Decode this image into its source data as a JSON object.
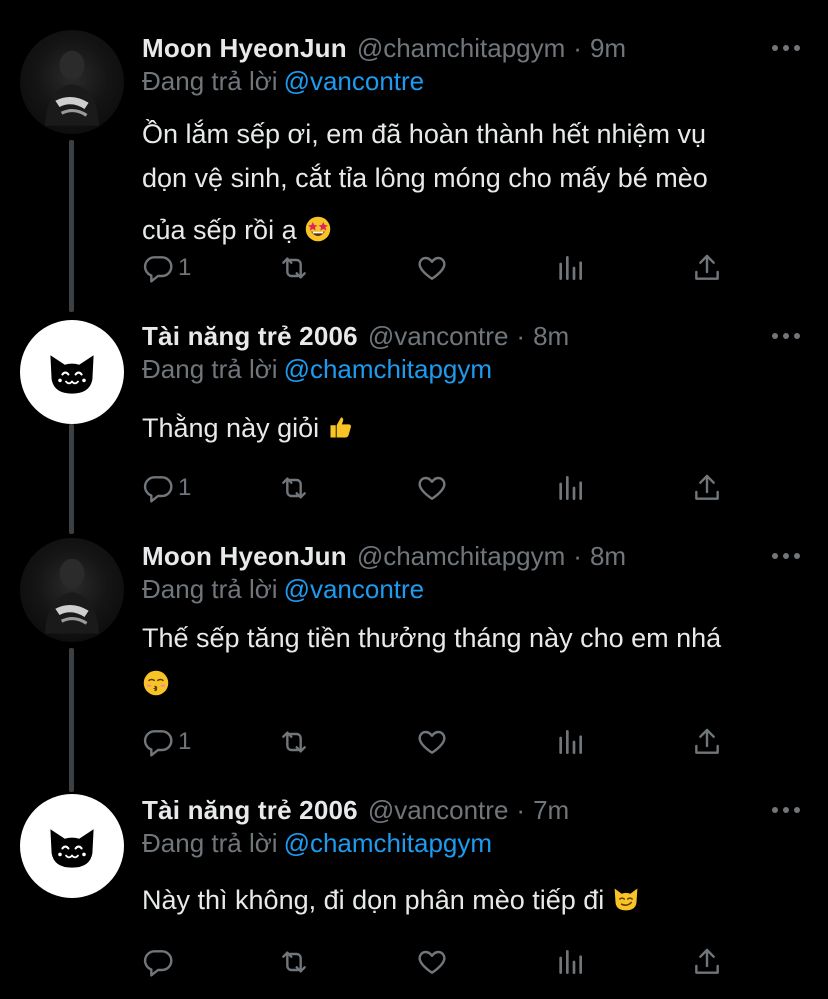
{
  "tweets": [
    {
      "name": "Moon HyeonJun",
      "handle": "@chamchitapgym",
      "time": "9m",
      "replying_prefix": "Đang trả lời",
      "replying_to": "@vancontre",
      "text_lines": [
        "Ồn lắm sếp ơi, em đã hoàn thành hết nhiệm vụ",
        "dọn vệ sinh, cắt tỉa lông móng cho mấy bé mèo",
        "của sếp rồi ạ"
      ],
      "emoji": "star-struck",
      "reply_count": "1",
      "avatar": "dark-photo"
    },
    {
      "name": "Tài năng trẻ 2006",
      "handle": "@vancontre",
      "time": "8m",
      "replying_prefix": "Đang trả lời",
      "replying_to": "@chamchitapgym",
      "text_lines": [
        "Thằng này giỏi"
      ],
      "emoji": "thumbs-up",
      "reply_count": "1",
      "avatar": "black-cat"
    },
    {
      "name": "Moon HyeonJun",
      "handle": "@chamchitapgym",
      "time": "8m",
      "replying_prefix": "Đang trả lời",
      "replying_to": "@vancontre",
      "text_lines": [
        "Thế sếp tăng tiền thưởng tháng này cho em nhá"
      ],
      "emoji": "kissing-face",
      "reply_count": "1",
      "avatar": "dark-photo"
    },
    {
      "name": "Tài năng trẻ 2006",
      "handle": "@vancontre",
      "time": "7m",
      "replying_prefix": "Đang trả lời",
      "replying_to": "@chamchitapgym",
      "text_lines": [
        "Này thì không, đi dọn phân mèo tiếp đi"
      ],
      "emoji": "smirking-cat",
      "reply_count": "",
      "avatar": "black-cat"
    }
  ],
  "colors": {
    "background": "#000000",
    "text": "#e7e9ea",
    "muted": "#71767b",
    "link": "#1d9bf0",
    "thread_line": "#3c4043"
  }
}
